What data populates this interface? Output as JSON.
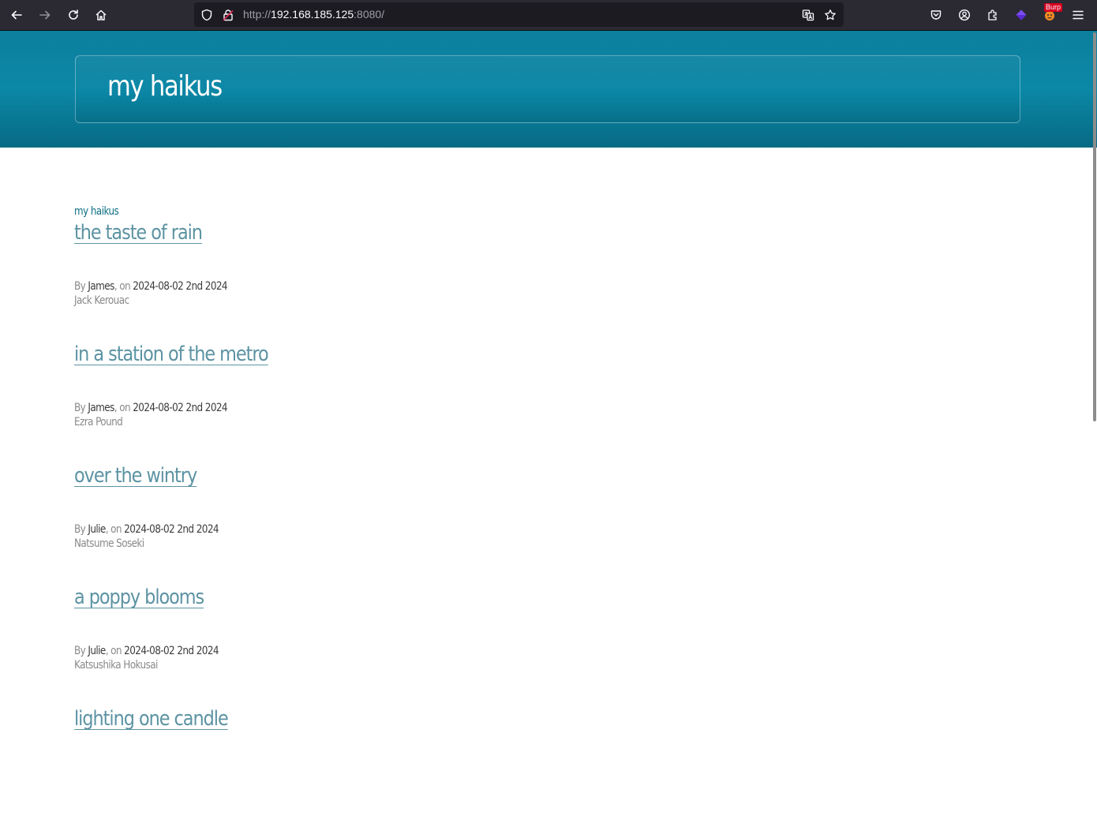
{
  "browser": {
    "url_prefix": "http://",
    "url_host": "192.168.185.125",
    "url_suffix": ":8080/",
    "burp_badge": "Burp"
  },
  "site": {
    "title": "my haikus",
    "breadcrumb": "my haikus"
  },
  "posts": [
    {
      "title": "the taste of rain",
      "by": "By ",
      "user": "James",
      "on": ", on ",
      "date": "2024-08-02 2nd 2024",
      "author": "Jack Kerouac"
    },
    {
      "title": "in a station of the metro",
      "by": "By ",
      "user": "James",
      "on": ", on ",
      "date": "2024-08-02 2nd 2024",
      "author": "Ezra Pound"
    },
    {
      "title": "over the wintry",
      "by": "By ",
      "user": "Julie",
      "on": ", on ",
      "date": "2024-08-02 2nd 2024",
      "author": "Natsume Soseki"
    },
    {
      "title": "a poppy blooms",
      "by": "By ",
      "user": "Julie",
      "on": ", on ",
      "date": "2024-08-02 2nd 2024",
      "author": "Katsushika Hokusai"
    },
    {
      "title": "lighting one candle"
    }
  ],
  "colors": {
    "header_bg": "#0b88a6",
    "link": "#5c93a3",
    "breadcrumb": "#0e6f86"
  }
}
